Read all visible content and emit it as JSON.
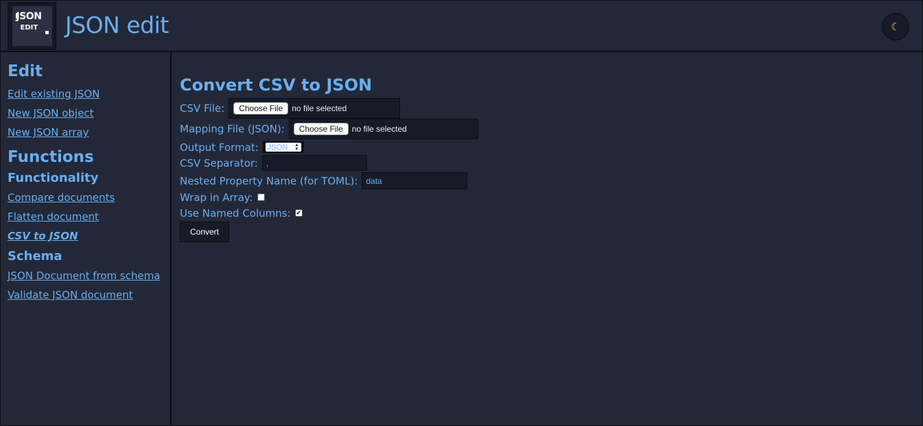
{
  "header": {
    "logo_text_top": "JSON",
    "logo_text_bottom": "EDIT",
    "title": "JSON edit",
    "theme_toggle_icon": "☾"
  },
  "sidebar": {
    "edit_heading": "Edit",
    "edit_links": [
      "Edit existing JSON",
      "New JSON object",
      "New JSON array"
    ],
    "functions_heading": "Functions",
    "functionality_heading": "Functionality",
    "functionality_links": [
      "Compare documents",
      "Flatten document",
      "CSV to JSON"
    ],
    "active_link": "CSV to JSON",
    "schema_heading": "Schema",
    "schema_links": [
      "JSON Document from schema",
      "Validate JSON document"
    ]
  },
  "main": {
    "title": "Convert CSV to JSON",
    "csv_file_label": "CSV File:",
    "mapping_file_label": "Mapping File (JSON):",
    "choose_file_label": "Choose File",
    "no_file_text": "no file selected",
    "output_format_label": "Output Format:",
    "output_format_value": "JSON",
    "csv_separator_label": "CSV Separator:",
    "csv_separator_value": ",",
    "nested_property_label": "Nested Property Name (for TOML):",
    "nested_property_value": "data",
    "wrap_in_array_label": "Wrap in Array:",
    "wrap_in_array_checked": false,
    "use_named_columns_label": "Use Named Columns:",
    "use_named_columns_checked": true,
    "convert_label": "Convert"
  }
}
